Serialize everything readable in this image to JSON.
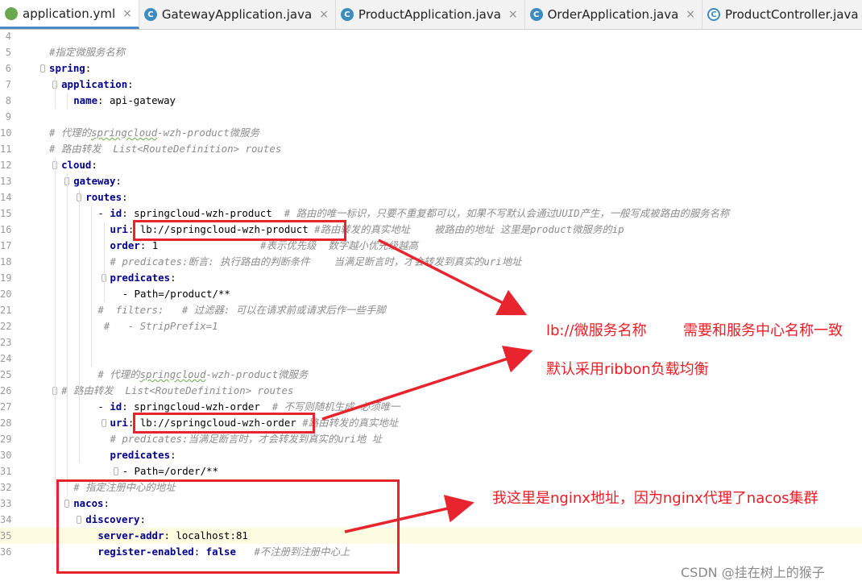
{
  "tabs": [
    {
      "label": "application.yml",
      "icon": "yaml-file-icon",
      "active": true
    },
    {
      "label": "GatewayApplication.java",
      "icon": "java-class-icon",
      "active": false
    },
    {
      "label": "ProductApplication.java",
      "icon": "java-class-icon",
      "active": false
    },
    {
      "label": "OrderApplication.java",
      "icon": "java-class-icon",
      "active": false
    },
    {
      "label": "ProductController.java",
      "icon": "java-class-icon",
      "active": false
    }
  ],
  "tab_close_glyph": "×",
  "highlighted_line": "35",
  "lines": [
    {
      "n": "4",
      "indent": 0,
      "parts": []
    },
    {
      "n": "5",
      "indent": 0,
      "parts": [
        [
          "c",
          "#指定微服务名称"
        ]
      ]
    },
    {
      "n": "6",
      "indent": 0,
      "parts": [
        [
          "k",
          "spring"
        ],
        [
          "p",
          ":"
        ]
      ]
    },
    {
      "n": "7",
      "indent": 1,
      "parts": [
        [
          "k",
          "application"
        ],
        [
          "p",
          ":"
        ]
      ]
    },
    {
      "n": "8",
      "indent": 2,
      "parts": [
        [
          "k",
          "name"
        ],
        [
          "p",
          ": "
        ],
        [
          "v",
          "api-gateway"
        ]
      ]
    },
    {
      "n": "9",
      "indent": 0,
      "parts": []
    },
    {
      "n": "10",
      "indent": 0,
      "parts": [
        [
          "c",
          "# 代理的"
        ],
        [
          "cw",
          "springcloud"
        ],
        [
          "c",
          "-wzh-product微服务"
        ]
      ]
    },
    {
      "n": "11",
      "indent": 0,
      "parts": [
        [
          "c",
          "# 路由转发  List<RouteDefinition> routes"
        ]
      ]
    },
    {
      "n": "12",
      "indent": 1,
      "parts": [
        [
          "k",
          "cloud"
        ],
        [
          "p",
          ":"
        ]
      ]
    },
    {
      "n": "13",
      "indent": 2,
      "parts": [
        [
          "k",
          "gateway"
        ],
        [
          "p",
          ":"
        ]
      ]
    },
    {
      "n": "14",
      "indent": 3,
      "parts": [
        [
          "k",
          "routes"
        ],
        [
          "p",
          ":"
        ]
      ]
    },
    {
      "n": "15",
      "indent": 4,
      "parts": [
        [
          "p",
          "- "
        ],
        [
          "k",
          "id"
        ],
        [
          "p",
          ": "
        ],
        [
          "v",
          "springcloud-wzh-product  "
        ],
        [
          "c",
          "# 路由的唯一标识，只要不重复都可以，如果不写默认会通过UUID产生，一般写成被路由的服务名称"
        ]
      ]
    },
    {
      "n": "16",
      "indent": 5,
      "parts": [
        [
          "k",
          "uri"
        ],
        [
          "p",
          ": "
        ],
        [
          "v",
          "lb://springcloud-wzh-product "
        ],
        [
          "c",
          "#路由转发的真实地址    被路由的地址 这里是product微服务的ip"
        ]
      ]
    },
    {
      "n": "17",
      "indent": 5,
      "parts": [
        [
          "k",
          "order"
        ],
        [
          "p",
          ": "
        ],
        [
          "v",
          "1                 "
        ],
        [
          "c",
          "#表示优先级  数字越小优先级越高"
        ]
      ]
    },
    {
      "n": "18",
      "indent": 5,
      "parts": [
        [
          "c",
          "# predicates:断言: 执行路由的判断条件    当满足断言时，才会转发到真实的uri地址"
        ]
      ]
    },
    {
      "n": "19",
      "indent": 5,
      "parts": [
        [
          "k",
          "predicates"
        ],
        [
          "p",
          ":"
        ]
      ]
    },
    {
      "n": "20",
      "indent": 6,
      "parts": [
        [
          "p",
          "- "
        ],
        [
          "v",
          "Path=/product/**"
        ]
      ]
    },
    {
      "n": "21",
      "indent": 4,
      "parts": [
        [
          "c",
          "#  filters:   # 过滤器: 可以在请求前或请求后作一些手脚"
        ]
      ]
    },
    {
      "n": "22",
      "indent": 4,
      "parts": [
        [
          "c",
          " #   - StripPrefix=1"
        ]
      ]
    },
    {
      "n": "23",
      "indent": 0,
      "parts": []
    },
    {
      "n": "24",
      "indent": 0,
      "parts": []
    },
    {
      "n": "25",
      "indent": 4,
      "parts": [
        [
          "c",
          "# 代理的"
        ],
        [
          "cw",
          "springcloud"
        ],
        [
          "c",
          "-wzh-product微服务"
        ]
      ]
    },
    {
      "n": "26",
      "indent": 1,
      "parts": [
        [
          "c",
          "# 路由转发  List<RouteDefinition> routes"
        ]
      ]
    },
    {
      "n": "27",
      "indent": 4,
      "parts": [
        [
          "p",
          "- "
        ],
        [
          "k",
          "id"
        ],
        [
          "p",
          ": "
        ],
        [
          "v",
          "springcloud-wzh-order  "
        ],
        [
          "c",
          "# 不写则随机生成 必须唯一"
        ]
      ]
    },
    {
      "n": "28",
      "indent": 5,
      "parts": [
        [
          "k",
          "uri"
        ],
        [
          "p",
          ": "
        ],
        [
          "v",
          "lb://springcloud-wzh-order "
        ],
        [
          "c",
          "#路由转发的真实地址"
        ]
      ]
    },
    {
      "n": "29",
      "indent": 5,
      "parts": [
        [
          "c",
          "# predicates:当满足断言时，才会转发到真实的uri地 址"
        ]
      ]
    },
    {
      "n": "30",
      "indent": 5,
      "parts": [
        [
          "k",
          "predicates"
        ],
        [
          "p",
          ":"
        ]
      ]
    },
    {
      "n": "31",
      "indent": 6,
      "parts": [
        [
          "p",
          "- "
        ],
        [
          "v",
          "Path=/order/**"
        ]
      ]
    },
    {
      "n": "32",
      "indent": 2,
      "parts": [
        [
          "c",
          "# 指定注册中心的地址"
        ]
      ]
    },
    {
      "n": "33",
      "indent": 2,
      "parts": [
        [
          "k",
          "nacos"
        ],
        [
          "p",
          ":"
        ]
      ]
    },
    {
      "n": "34",
      "indent": 3,
      "parts": [
        [
          "k",
          "discovery"
        ],
        [
          "p",
          ":"
        ]
      ]
    },
    {
      "n": "35",
      "indent": 4,
      "parts": [
        [
          "k",
          "server-addr"
        ],
        [
          "p",
          ": "
        ],
        [
          "v",
          "localhost:81"
        ]
      ]
    },
    {
      "n": "36",
      "indent": 4,
      "parts": [
        [
          "k",
          "register-enabled"
        ],
        [
          "p",
          ": "
        ],
        [
          "k",
          "false"
        ],
        [
          "p",
          "   "
        ],
        [
          "c",
          "#不注册到注册中心上"
        ]
      ]
    }
  ],
  "annotations": {
    "lb_note": "lb://微服务名称",
    "lb_note2": "需要和服务中心名称一致",
    "ribbon_note": "默认采用ribbon负载均衡",
    "nginx_note": "我这里是nginx地址，因为nginx代理了nacos集群"
  },
  "annotation_color": "#ee1c25",
  "watermark": "CSDN @挂在树上的猴子"
}
